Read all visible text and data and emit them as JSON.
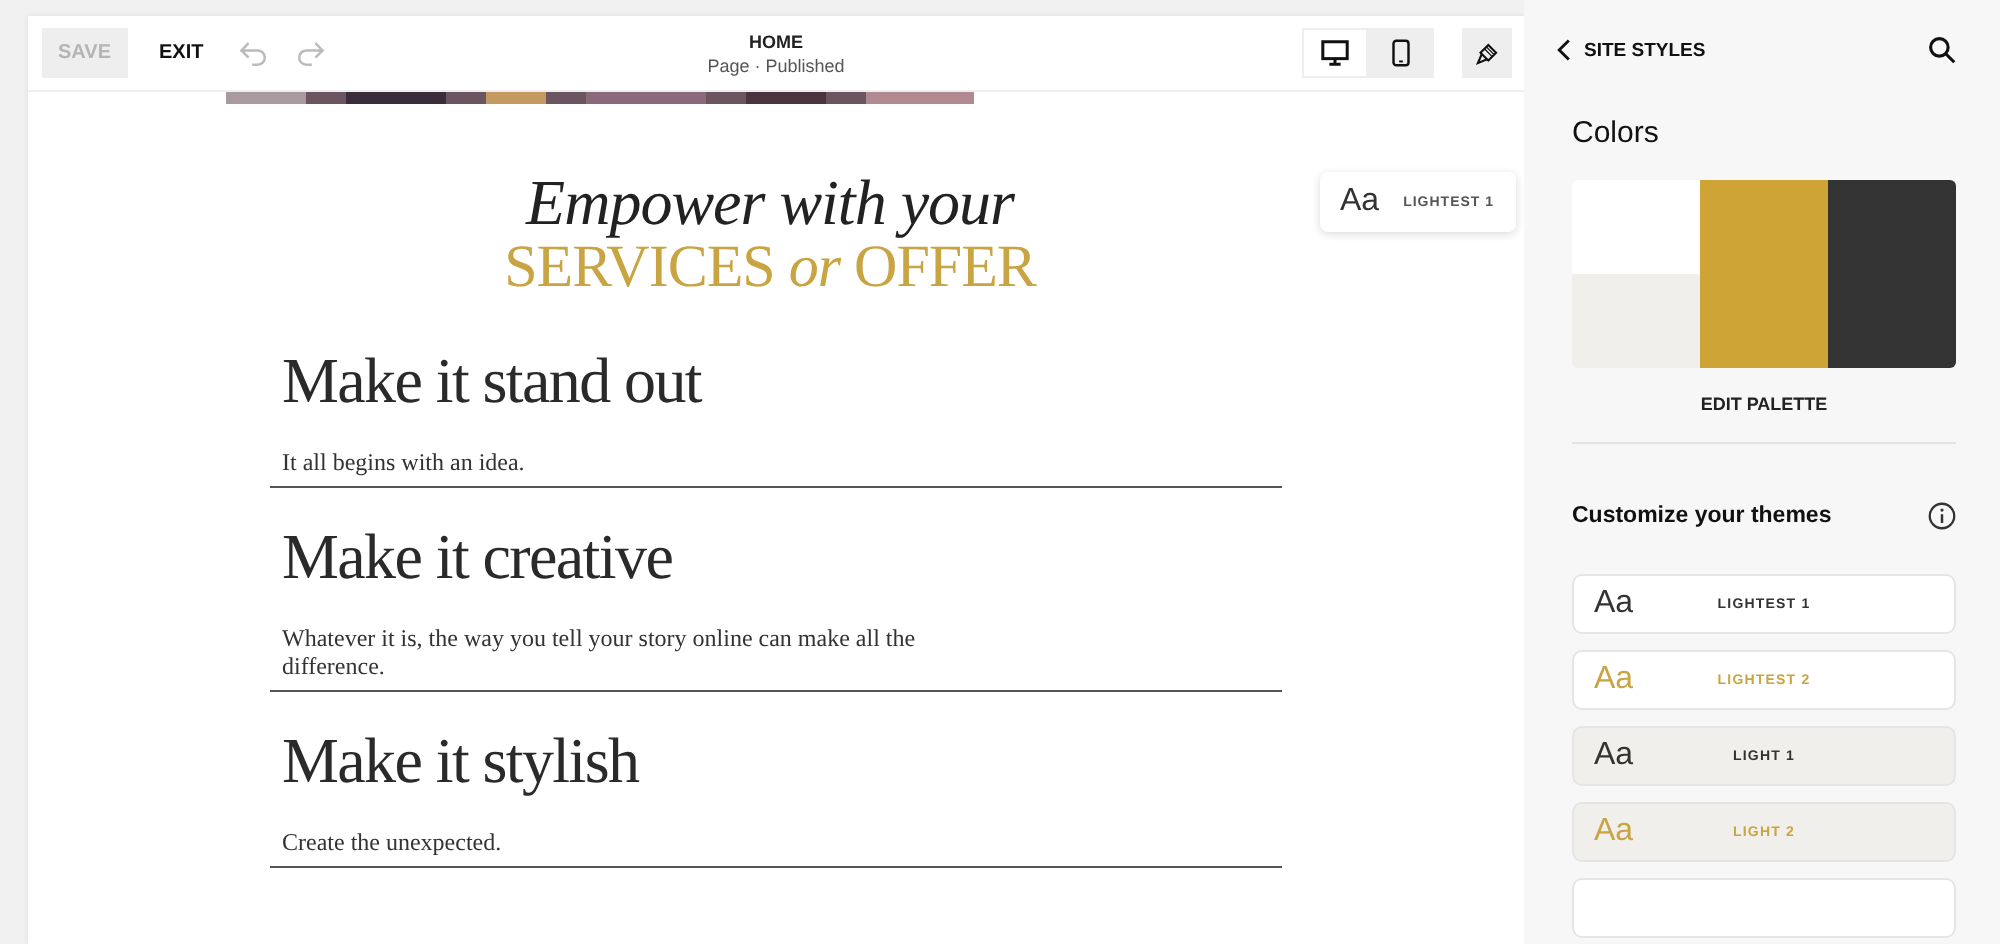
{
  "toolbar": {
    "save": {
      "label": "SAVE",
      "disabled": true
    },
    "exit": "EXIT",
    "undo_disabled": true,
    "redo_disabled": true,
    "page_title": "HOME",
    "page_status": "Page · Published",
    "devices": [
      {
        "kind": "desktop",
        "selected": true
      },
      {
        "kind": "mobile",
        "selected": false
      }
    ]
  },
  "canvas": {
    "headline": "Empower with your",
    "subheadline": "SERVICES *or* OFFER",
    "theme_badge": {
      "sample": "Aa",
      "label": "LIGHTEST 1"
    },
    "sections": [
      {
        "heading": "Make it stand out",
        "body": "It all begins with an idea."
      },
      {
        "heading": "Make it creative",
        "body": "Whatever it is, the way you tell your story online can make all the difference."
      },
      {
        "heading": "Make it stylish",
        "body": "Create the unexpected."
      }
    ]
  },
  "sidebar": {
    "back": "SITE STYLES",
    "colors_title": "Colors",
    "palette": [
      {
        "color": "#ffffff"
      },
      {
        "color": "#f0efeb"
      },
      {
        "color": "#cfa436"
      },
      {
        "color": "#333333"
      }
    ],
    "edit_palette": "EDIT PALETTE",
    "themes_title": "Customize your themes",
    "themes": [
      {
        "sample": "Aa",
        "label": "LIGHTEST 1",
        "color": "#333333",
        "kind": "lightest"
      },
      {
        "sample": "Aa",
        "label": "LIGHTEST 2",
        "color": "#c9a443",
        "kind": "lightest"
      },
      {
        "sample": "Aa",
        "label": "LIGHT 1",
        "color": "#333333",
        "kind": "light"
      },
      {
        "sample": "Aa",
        "label": "LIGHT 2",
        "color": "#c9a443",
        "kind": "light"
      },
      {
        "kind": "lightest"
      }
    ]
  }
}
